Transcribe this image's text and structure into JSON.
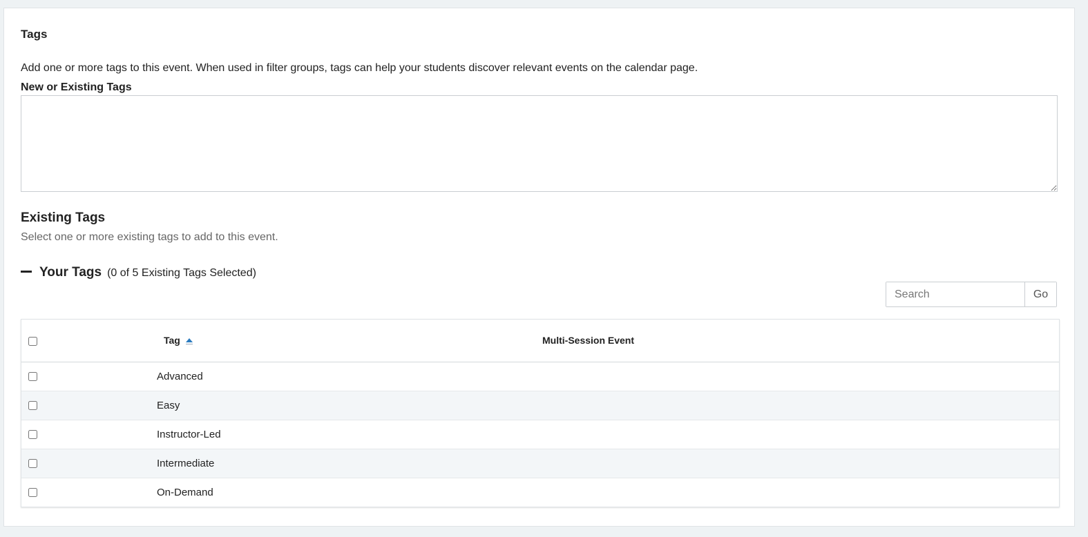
{
  "section": {
    "title": "Tags",
    "description": "Add one or more tags to this event. When used in filter groups, tags can help your students discover relevant events on the calendar page.",
    "field_label": "New or Existing Tags",
    "field_value": ""
  },
  "existing": {
    "title": "Existing Tags",
    "subtitle": "Select one or more existing tags to add to this event."
  },
  "your_tags": {
    "title": "Your Tags",
    "count_text": "(0 of 5 Existing Tags Selected)"
  },
  "search": {
    "placeholder": "Search",
    "button_label": "Go"
  },
  "table": {
    "columns": [
      "Tag",
      "Multi-Session Event"
    ],
    "sort_column": "Tag",
    "sort_direction": "ascending",
    "rows": [
      {
        "tag": "Advanced",
        "multi_session": "",
        "checked": false
      },
      {
        "tag": "Easy",
        "multi_session": "",
        "checked": false
      },
      {
        "tag": "Instructor-Led",
        "multi_session": "",
        "checked": false
      },
      {
        "tag": "Intermediate",
        "multi_session": "",
        "checked": false
      },
      {
        "tag": "On-Demand",
        "multi_session": "",
        "checked": false
      }
    ]
  },
  "colors": {
    "page_background": "#eef2f4",
    "row_alt": "#f3f6f8",
    "sort_accent": "#2b7bbf"
  }
}
